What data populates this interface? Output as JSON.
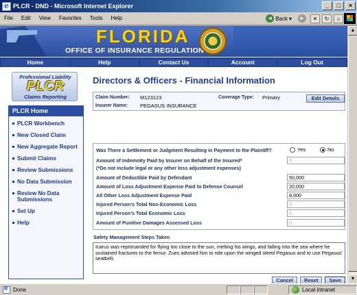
{
  "window": {
    "title": "PLCR - DND - Microsoft Internet Explorer"
  },
  "menu": {
    "items": [
      {
        "label": "File"
      },
      {
        "label": "Edit"
      },
      {
        "label": "View"
      },
      {
        "label": "Favorites"
      },
      {
        "label": "Tools"
      },
      {
        "label": "Help"
      }
    ]
  },
  "toolbar": {
    "back_label": "Back"
  },
  "header": {
    "title": "FLORIDA",
    "subtitle": "OFFICE OF INSURANCE REGULATION"
  },
  "nav": {
    "home": "Home",
    "help": "Help",
    "contact": "Contact Us",
    "account": "Account",
    "logout": "Log Out"
  },
  "logo": {
    "top": "Professional Liability",
    "big": "PLCR",
    "bottom": "Claims Reporting"
  },
  "sidebar": {
    "heading": "PLCR Home",
    "items": [
      {
        "label": "PLCR Workbench"
      },
      {
        "label": "New Closed Claim"
      },
      {
        "label": "New Aggregate Report"
      },
      {
        "label": "Submit Claims"
      },
      {
        "label": "Review Submissions"
      },
      {
        "label": "No Data Submission"
      },
      {
        "label": "Review No Data Submissions"
      },
      {
        "label": "Set Up"
      },
      {
        "label": "Help"
      }
    ]
  },
  "main": {
    "title": "Directors & Officers - Financial Information",
    "claim_number_label": "Claim Number:",
    "claim_number": "M123123",
    "insurer_label": "Insurer Name:",
    "insurer": "PEGASUS INSURANCE",
    "coverage_label": "Coverage Type:",
    "coverage": "Primary",
    "edit_label": "Edit Details"
  },
  "form": {
    "settlement_question": "Was There a Settlement or Judgment Resulting in Payment to the Plaintiff?",
    "yes_label": "Yes",
    "no_label": "No",
    "settlement_selected": "No",
    "indemnity_label": "Amount of Indemnity Paid by Insurer on Behalf of the Insured*",
    "indemnity_note": "(*Do not include legal or any other loss adjustment expenses)",
    "indemnity_value": "0",
    "deductible_label": "Amount of Deductible Paid by Defendant",
    "deductible_value": "50,000",
    "loss_adj_label": "Amount of Loss Adjustment Expense Paid to Defense Counsel",
    "loss_adj_value": "20,000",
    "other_loss_label": "All Other Loss Adjustment Expense Paid",
    "other_loss_value": "8,000",
    "non_economic_label": "Injured Person's Total Non-Economic Loss",
    "non_economic_value": "0",
    "economic_label": "Injured Person's Total Economic Loss",
    "economic_value": "0",
    "punitive_label": "Amount of Punitive Damages Assessed Loss",
    "punitive_value": "0"
  },
  "safety": {
    "label": "Safety Management Steps Taken",
    "text": "Icarus was reprimanded for flying too close to the sun, melting his wings, and falling into the sea where he sustained fractures to the femur.  Zues advised him to ride upon the winged steed Pegasus and to use Pegasus' seatbelt."
  },
  "buttons": {
    "cancel": "Cancel",
    "reset": "Reset",
    "save": "Save"
  },
  "status": {
    "text": "Done",
    "zone": "Local intranet"
  }
}
